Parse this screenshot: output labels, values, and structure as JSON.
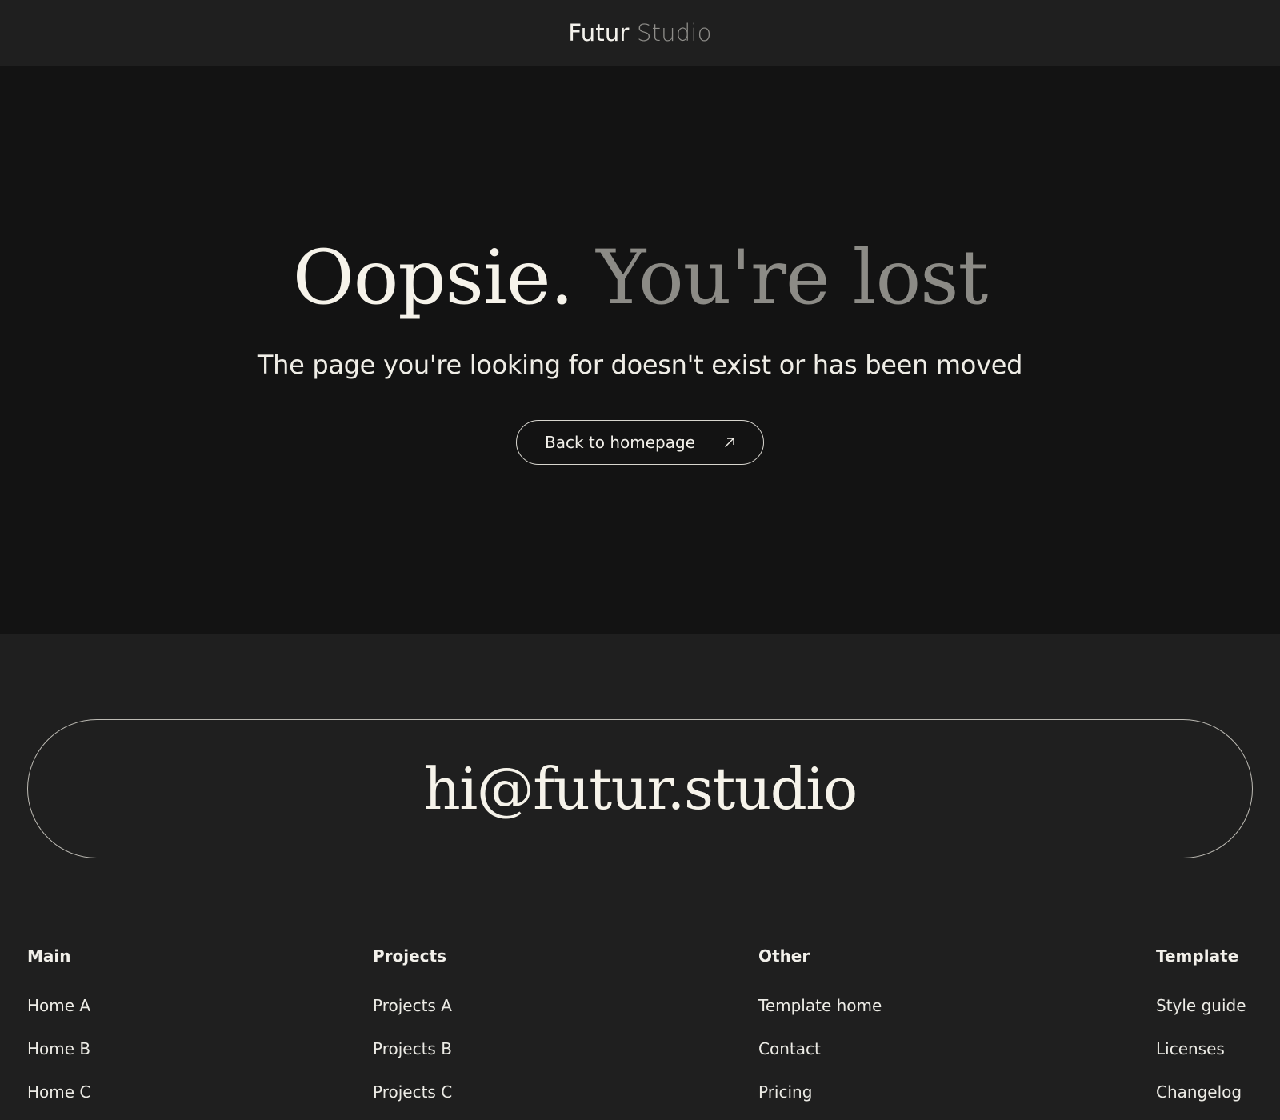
{
  "header": {
    "logo_primary": "Futur",
    "logo_secondary": "Studio"
  },
  "hero": {
    "title_part1": "Oopsie.",
    "title_part2": "You're lost",
    "subtitle": "The page you're looking for doesn't exist or has been moved",
    "button_label": "Back to homepage",
    "button_icon": "arrow-up-right-icon"
  },
  "footer": {
    "email": "hi@futur.studio",
    "columns": [
      {
        "heading": "Main",
        "links": [
          "Home A",
          "Home B",
          "Home C"
        ]
      },
      {
        "heading": "Projects",
        "links": [
          "Projects A",
          "Projects B",
          "Projects C"
        ]
      },
      {
        "heading": "Other",
        "links": [
          "Template home",
          "Contact",
          "Pricing"
        ]
      },
      {
        "heading": "Template",
        "links": [
          "Style guide",
          "Licenses",
          "Changelog"
        ]
      }
    ]
  },
  "colors": {
    "header_bg": "#1f1f1f",
    "hero_bg": "#131313",
    "footer_bg": "#1f1f1f",
    "text_primary": "#f6f3ea",
    "text_muted": "#8c8b86"
  }
}
